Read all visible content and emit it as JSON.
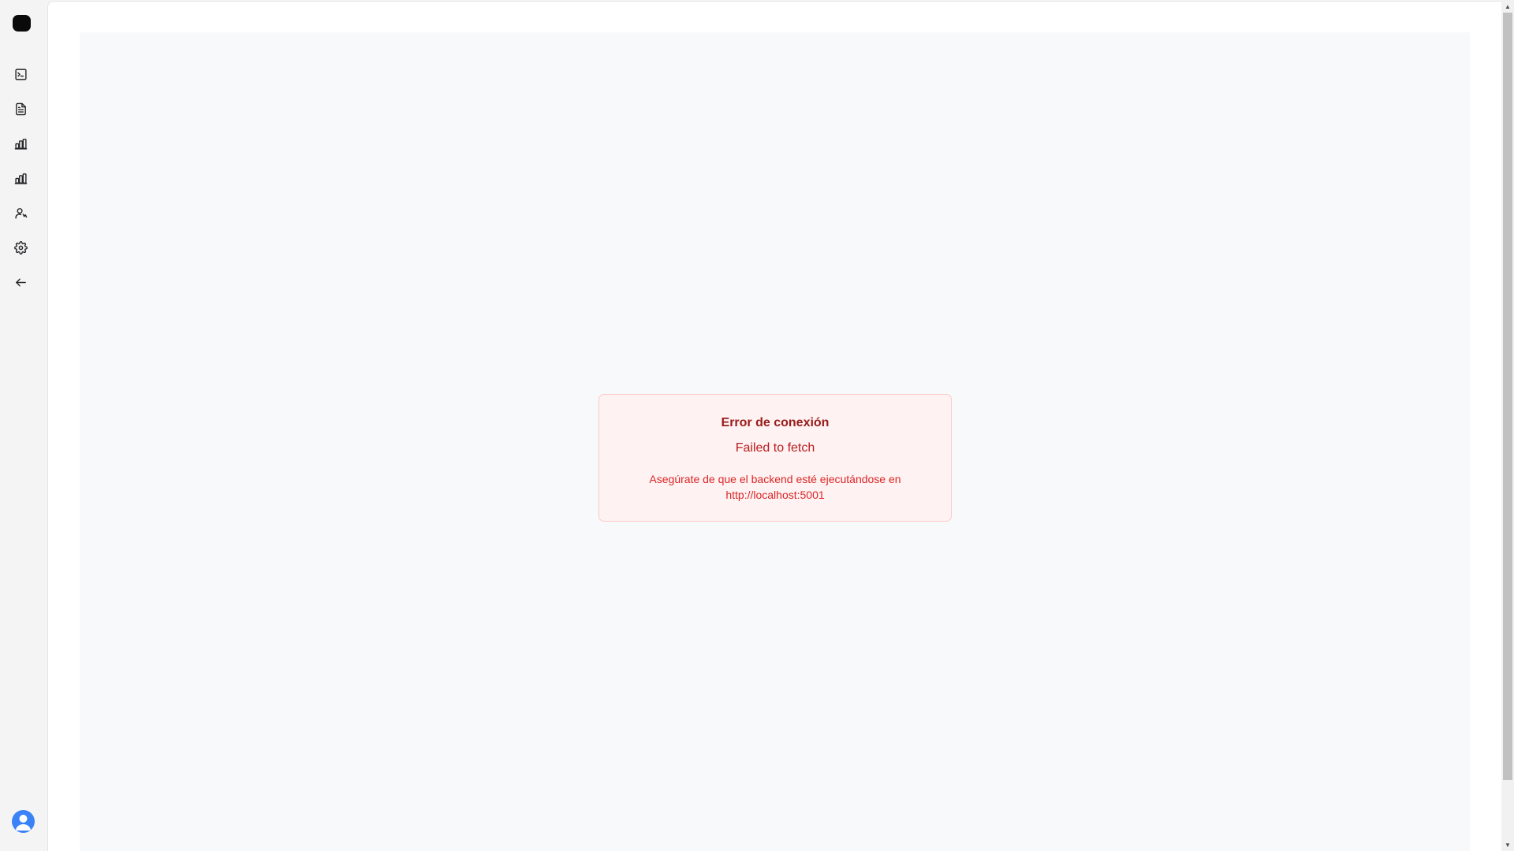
{
  "sidebar": {
    "items": [
      {
        "icon": "terminal-icon",
        "name": "sidebar-item-terminal"
      },
      {
        "icon": "document-icon",
        "name": "sidebar-item-documents"
      },
      {
        "icon": "bar-chart-icon",
        "name": "sidebar-item-analytics"
      },
      {
        "icon": "bar-chart-icon",
        "name": "sidebar-item-reports"
      },
      {
        "icon": "user-activity-icon",
        "name": "sidebar-item-users"
      },
      {
        "icon": "gear-icon",
        "name": "sidebar-item-settings"
      },
      {
        "icon": "arrow-left-icon",
        "name": "sidebar-item-back"
      }
    ],
    "avatar_icon": "user-avatar-icon"
  },
  "error": {
    "title": "Error de conexión",
    "message": "Failed to fetch",
    "hint": "Asegúrate de que el backend esté ejecutándose en http://localhost:5001"
  },
  "colors": {
    "error_bg": "#fef2f2",
    "error_border": "#fecaca",
    "error_title": "#991b1b",
    "error_text": "#dc2626",
    "avatar": "#3b82f6"
  }
}
